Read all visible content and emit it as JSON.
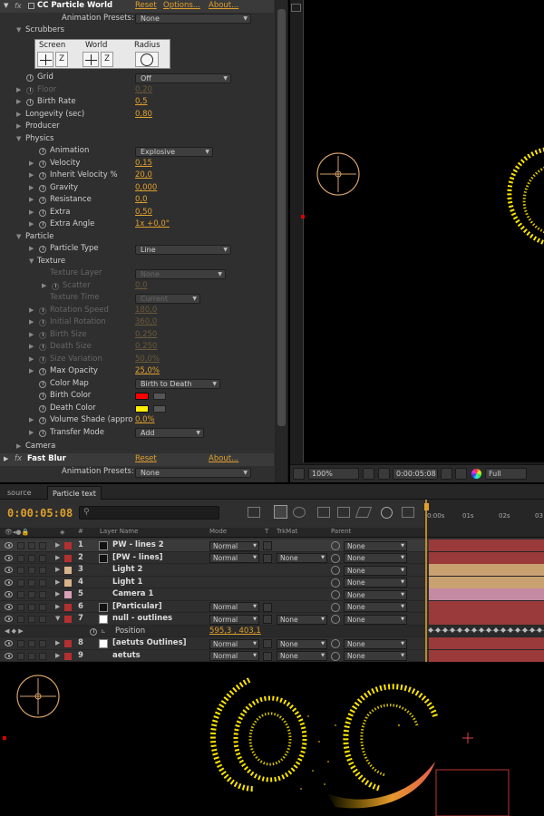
{
  "effect_controls": {
    "effect_name": "CC Particle World",
    "reset": "Reset",
    "options": "Options...",
    "about": "About...",
    "animation_presets_label": "Animation Presets:",
    "animation_presets_value": "None",
    "scrubbers_label": "Scrubbers",
    "scrubber_screen": "Screen",
    "scrubber_world": "World",
    "scrubber_radius": "Radius",
    "scrubber_z": "Z",
    "grid_label": "Grid",
    "grid_value": "Off",
    "floor_label": "Floor",
    "floor_value": "0,20",
    "birth_rate_label": "Birth Rate",
    "birth_rate_value": "0,5",
    "longevity_label": "Longevity (sec)",
    "longevity_value": "0,80",
    "producer_label": "Producer",
    "physics_label": "Physics",
    "animation_label": "Animation",
    "animation_value": "Explosive",
    "velocity_label": "Velocity",
    "velocity_value": "0,15",
    "inherit_label": "Inherit Velocity %",
    "inherit_value": "20,0",
    "gravity_label": "Gravity",
    "gravity_value": "0,000",
    "resistance_label": "Resistance",
    "resistance_value": "0,0",
    "extra_label": "Extra",
    "extra_value": "0,50",
    "extra_angle_label": "Extra Angle",
    "extra_angle_value": "1x +0,0°",
    "particle_label": "Particle",
    "particle_type_label": "Particle Type",
    "particle_type_value": "Line",
    "texture_label": "Texture",
    "texture_layer_label": "Texture Layer",
    "texture_layer_value": "None",
    "scatter_label": "Scatter",
    "scatter_value": "0,0",
    "texture_time_label": "Texture Time",
    "texture_time_value": "Current",
    "rotation_speed_label": "Rotation Speed",
    "rotation_speed_value": "180,0",
    "initial_rotation_label": "Initial Rotation",
    "initial_rotation_value": "360,0",
    "birth_size_label": "Birth Size",
    "birth_size_value": "0,250",
    "death_size_label": "Death Size",
    "death_size_value": "0,250",
    "size_variation_label": "Size Variation",
    "size_variation_value": "50,0%",
    "max_opacity_label": "Max Opacity",
    "max_opacity_value": "25,0%",
    "color_map_label": "Color Map",
    "color_map_value": "Birth to Death",
    "birth_color_label": "Birth Color",
    "birth_color": "#ff0000",
    "death_color_label": "Death Color",
    "death_color": "#ffee00",
    "volume_shade_label": "Volume Shade (appro",
    "volume_shade_value": "0,0%",
    "transfer_mode_label": "Transfer Mode",
    "transfer_mode_value": "Add",
    "camera_label": "Camera",
    "fast_blur_name": "Fast Blur",
    "fast_blur_reset": "Reset",
    "fast_blur_about": "About...",
    "fast_blur_presets_label": "Animation Presets:",
    "fast_blur_presets_value": "None"
  },
  "viewer": {
    "zoom": "100%",
    "timecode": "0:00:05:08",
    "resolution": "Full"
  },
  "timeline": {
    "tab_source": "source",
    "tab_active": "Particle text",
    "timecode": "0:00:05:08",
    "hdr_num": "#",
    "hdr_layer": "Layer Name",
    "hdr_mode": "Mode",
    "hdr_t": "T",
    "hdr_trkmat": "TrkMat",
    "hdr_parent": "Parent",
    "ruler": [
      "0:00s",
      "01s",
      "02s",
      "03"
    ],
    "position_label": "Position",
    "position_value": "595,3 , 403,1",
    "layers": [
      {
        "num": "1",
        "name": "PW - lines 2",
        "label_color": "#b33030",
        "icon": "solid-icon",
        "mode": "Normal",
        "trkmat": "",
        "parent": "None",
        "bar_color": "#9a3a3a"
      },
      {
        "num": "2",
        "name": "[PW - lines]",
        "label_color": "#b33030",
        "icon": "solid-icon",
        "mode": "Normal",
        "trkmat": "None",
        "parent": "None",
        "bar_color": "#9a3a3a"
      },
      {
        "num": "3",
        "name": "Light 2",
        "label_color": "#d9b48a",
        "icon": "light-icon",
        "mode": "",
        "trkmat": "",
        "parent": "None",
        "bar_color": "#c9a070"
      },
      {
        "num": "4",
        "name": "Light 1",
        "label_color": "#d9b48a",
        "icon": "light-icon",
        "mode": "",
        "trkmat": "",
        "parent": "None",
        "bar_color": "#c9a070"
      },
      {
        "num": "5",
        "name": "Camera 1",
        "label_color": "#d9a0b8",
        "icon": "camera-icon",
        "mode": "",
        "trkmat": "",
        "parent": "None",
        "bar_color": "#c48aa4"
      },
      {
        "num": "6",
        "name": "[Particular]",
        "label_color": "#b33030",
        "icon": "solid-icon",
        "mode": "Normal",
        "trkmat": "",
        "parent": "None",
        "bar_color": "#9a3a3a"
      },
      {
        "num": "7",
        "name": "null - outlines",
        "label_color": "#b33030",
        "icon": "null-icon",
        "mode": "Normal",
        "trkmat": "None",
        "parent": "None",
        "bar_color": "#9a3a3a"
      },
      {
        "num": "8",
        "name": "[aetuts Outlines]",
        "label_color": "#b33030",
        "icon": "null-icon",
        "mode": "Normal",
        "trkmat": "None",
        "parent": "None",
        "bar_color": "#9a3a3a"
      },
      {
        "num": "9",
        "name": "aetuts",
        "label_color": "#b33030",
        "icon": "text-icon",
        "mode": "Normal",
        "trkmat": "None",
        "parent": "None",
        "bar_color": "#9a3a3a"
      }
    ]
  }
}
